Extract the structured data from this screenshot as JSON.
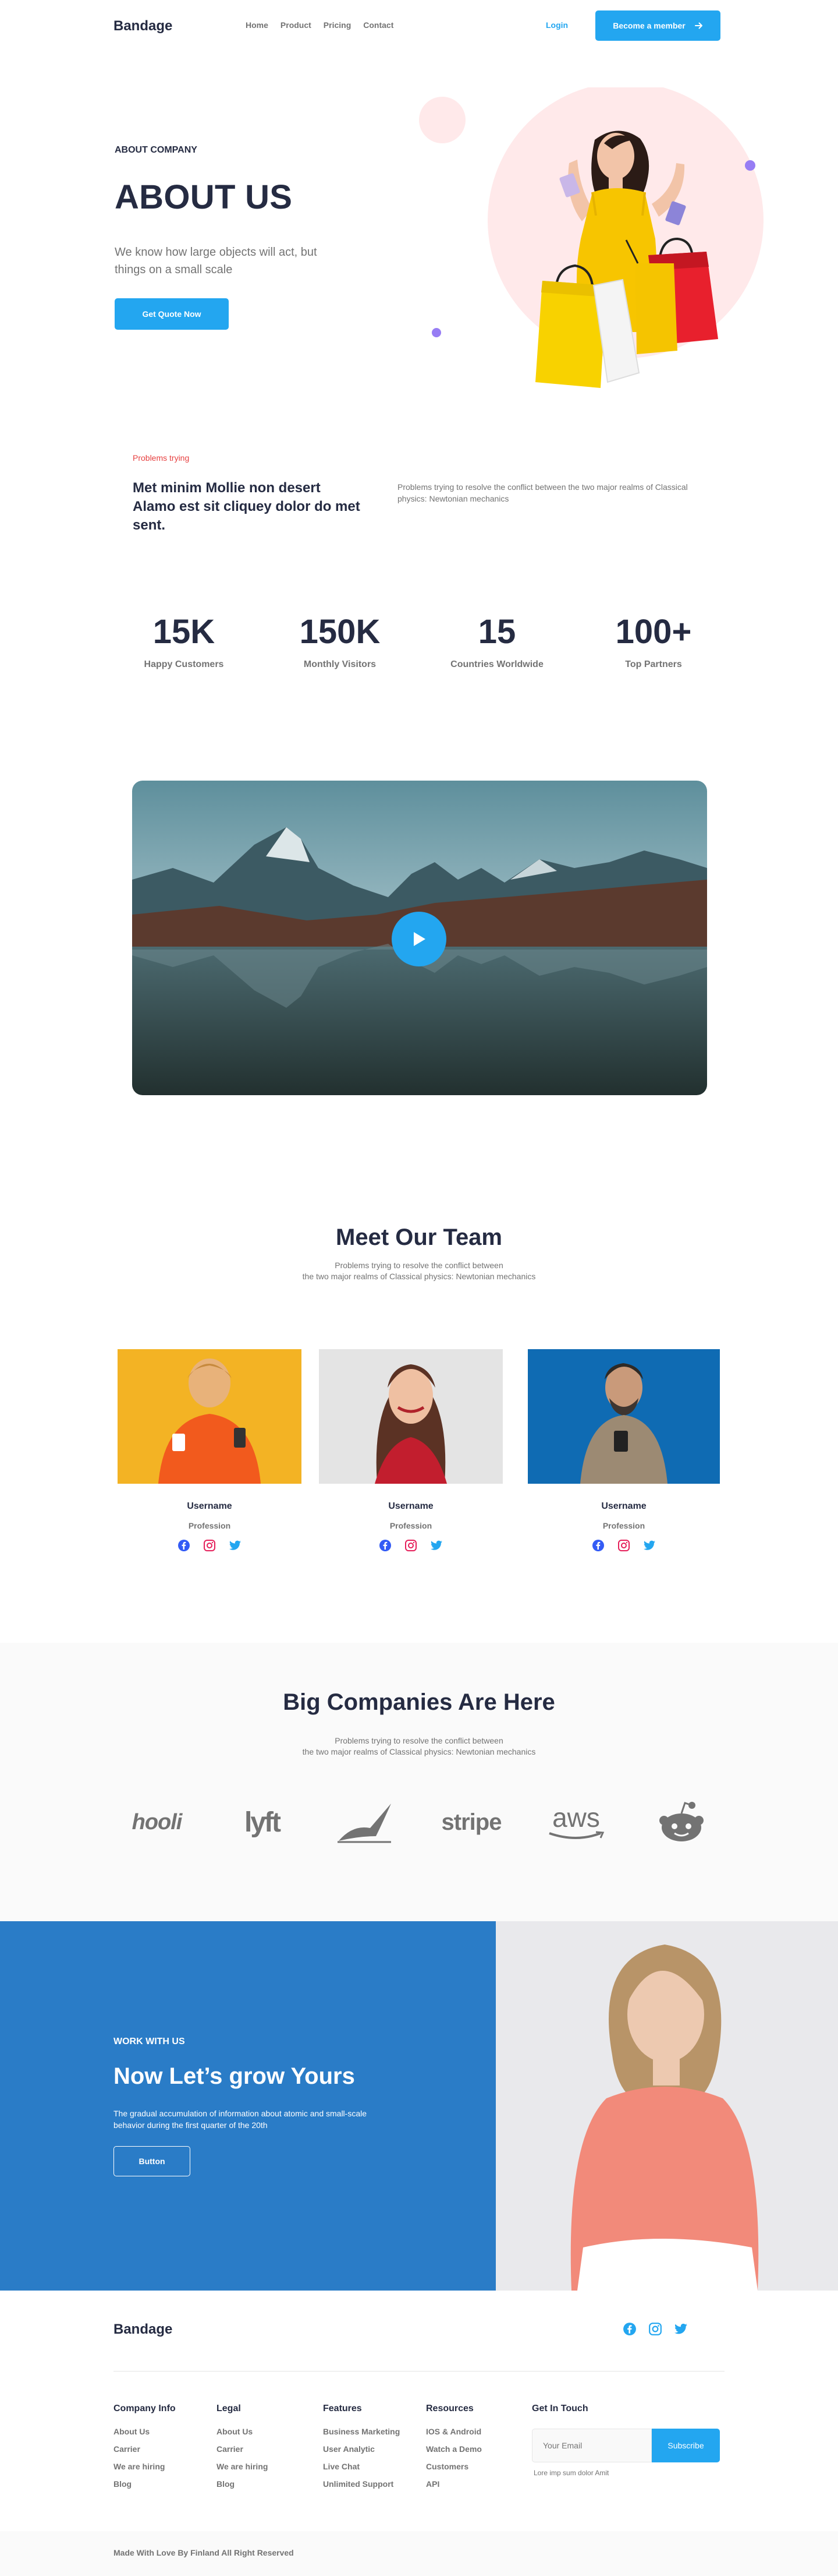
{
  "header": {
    "brand": "Bandage",
    "nav": [
      "Home",
      "Product",
      "Pricing",
      "Contact"
    ],
    "login": "Login",
    "member_button": "Become a member"
  },
  "hero": {
    "eyebrow": "ABOUT COMPANY",
    "title": "ABOUT US",
    "subtitle": "We know how large objects will act, but things on a small scale",
    "button": "Get Quote Now"
  },
  "problems": {
    "label": "Problems trying",
    "title": "Met minim Mollie non desert Alamo est sit cliquey dolor do met sent.",
    "text": "Problems trying to resolve the conflict between the two major realms of Classical physics: Newtonian mechanics"
  },
  "stats": [
    {
      "value": "15K",
      "label": "Happy Customers"
    },
    {
      "value": "150K",
      "label": "Monthly Visitors"
    },
    {
      "value": "15",
      "label": "Countries  Worldwide"
    },
    {
      "value": "100+",
      "label": "Top Partners"
    }
  ],
  "team": {
    "title": "Meet Our Team",
    "subtitle_line1": "Problems trying to resolve the conflict between",
    "subtitle_line2": "the two major realms of Classical physics: Newtonian mechanics",
    "members": [
      {
        "name": "Username",
        "profession": "Profession"
      },
      {
        "name": "Username",
        "profession": "Profession"
      },
      {
        "name": "Username",
        "profession": "Profession"
      }
    ]
  },
  "companies": {
    "title": "Big Companies Are Here",
    "subtitle_line1": "Problems trying to resolve the conflict between",
    "subtitle_line2": "the two major realms of Classical physics: Newtonian mechanics",
    "logos": [
      "hooli",
      "lyft",
      "stripe",
      "aws",
      "reddit"
    ]
  },
  "work": {
    "eyebrow": "WORK WITH US",
    "title": "Now Let’s grow Yours",
    "text": "The gradual accumulation of information about atomic and small-scale behavior during the first quarter of the 20th",
    "button": "Button"
  },
  "footer": {
    "brand": "Bandage",
    "columns": [
      {
        "title": "Company Info",
        "items": [
          "About Us",
          "Carrier",
          "We are hiring",
          "Blog"
        ]
      },
      {
        "title": "Legal",
        "items": [
          "About Us",
          "Carrier",
          "We are hiring",
          "Blog"
        ]
      },
      {
        "title": "Features",
        "items": [
          "Business Marketing",
          "User Analytic",
          "Live Chat",
          "Unlimited Support"
        ]
      },
      {
        "title": "Resources",
        "items": [
          "IOS & Android",
          "Watch a Demo",
          "Customers",
          "API"
        ]
      }
    ],
    "get_in_touch": "Get In Touch",
    "email_placeholder": "Your Email",
    "subscribe": "Subscribe",
    "email_note": "Lore imp sum dolor Amit",
    "copyright": "Made With Love By Finland All Right Reserved"
  },
  "colors": {
    "primary": "#23A6F0",
    "dark": "#252B42",
    "muted": "#737373",
    "danger": "#E74040",
    "work_bg": "#2A7CC7"
  }
}
